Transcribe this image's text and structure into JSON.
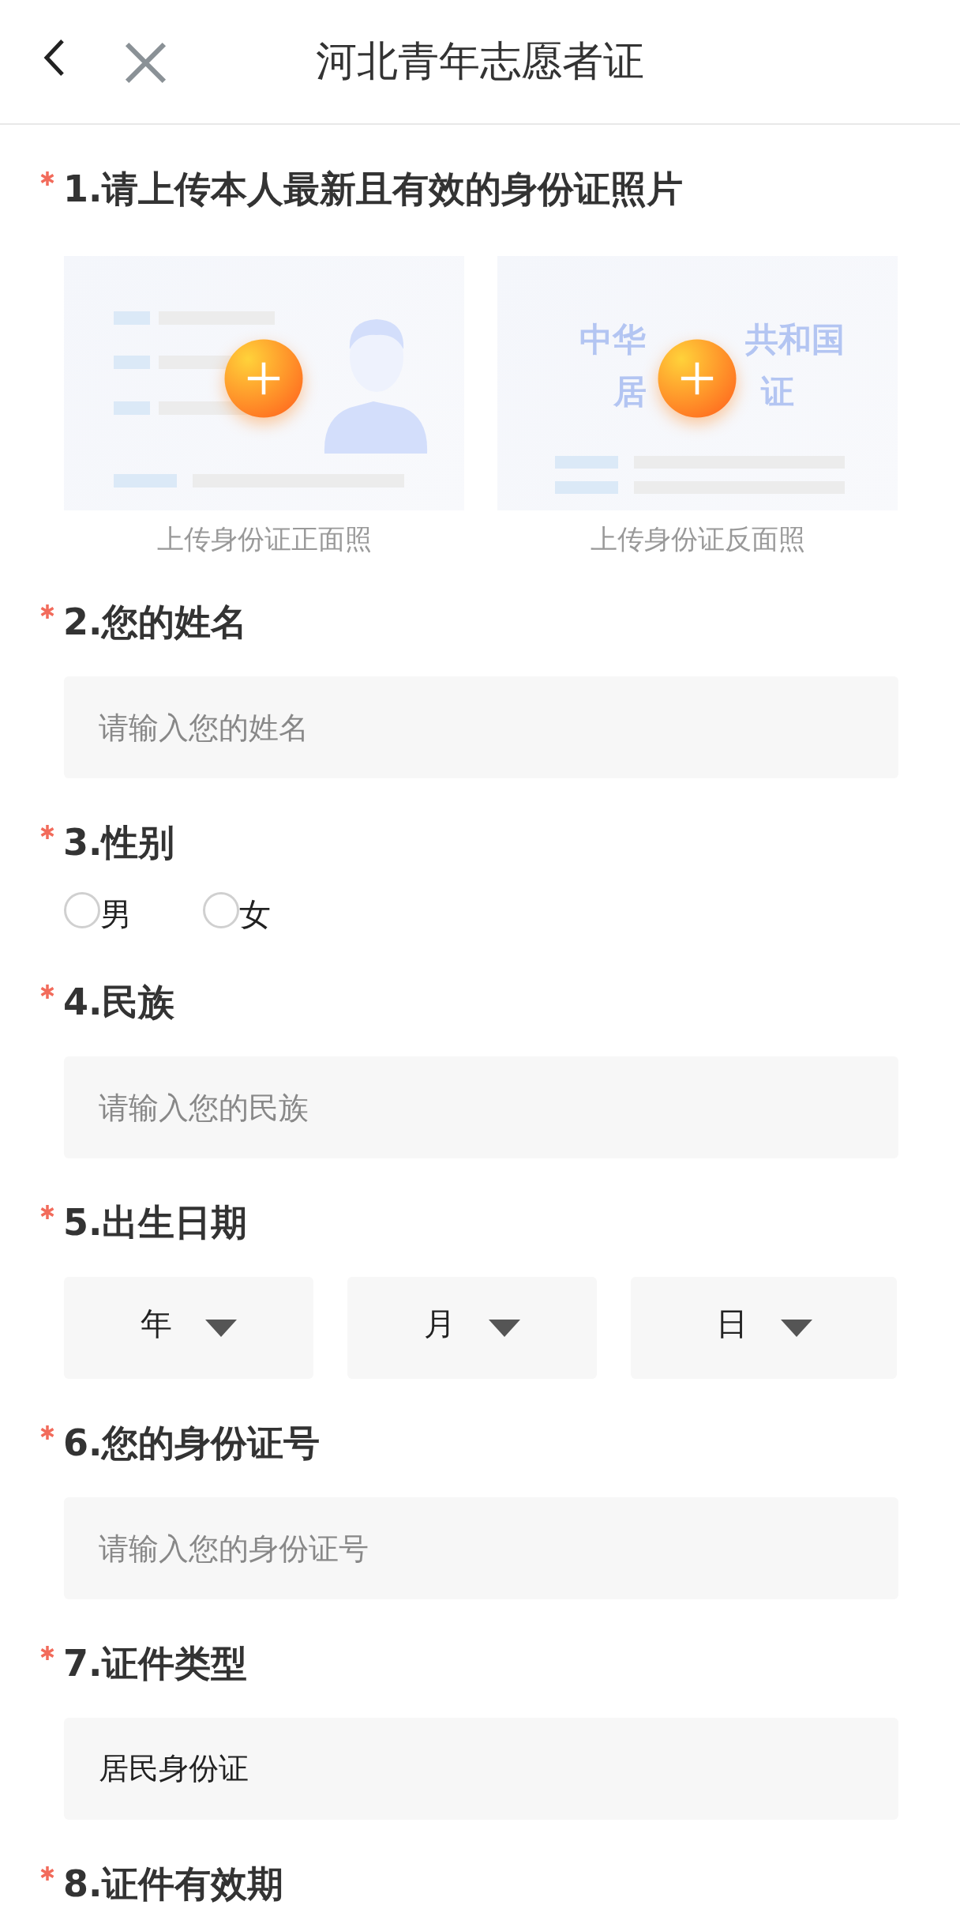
{
  "header": {
    "title": "河北青年志愿者证"
  },
  "questions": [
    {
      "kind": "upload",
      "required": true,
      "label": "1.请上传本人最新且有效的身份证照片",
      "cards": [
        {
          "kind": "front",
          "caption": "上传身份证正面照"
        },
        {
          "kind": "back",
          "caption": "上传身份证反面照",
          "card_text": [
            [
              "中华",
              "共和国"
            ],
            [
              "居",
              "证"
            ]
          ]
        }
      ]
    },
    {
      "kind": "input",
      "required": true,
      "label": "2.您的姓名",
      "placeholder": "请输入您的姓名"
    },
    {
      "kind": "radio",
      "required": true,
      "label": "3.性别",
      "options": [
        {
          "label": "男",
          "selected": false
        },
        {
          "label": "女",
          "selected": false
        }
      ]
    },
    {
      "kind": "input",
      "required": true,
      "label": "4.民族",
      "placeholder": "请输入您的民族"
    },
    {
      "kind": "date",
      "required": true,
      "label": "5.出生日期",
      "selects": [
        "年",
        "月",
        "日"
      ]
    },
    {
      "kind": "input",
      "required": true,
      "label": "6.您的身份证号",
      "placeholder": "请输入您的身份证号"
    },
    {
      "kind": "input",
      "required": true,
      "label": "7.证件类型",
      "value": "居民身份证"
    },
    {
      "kind": "title",
      "required": true,
      "label": "8.证件有效期"
    }
  ]
}
